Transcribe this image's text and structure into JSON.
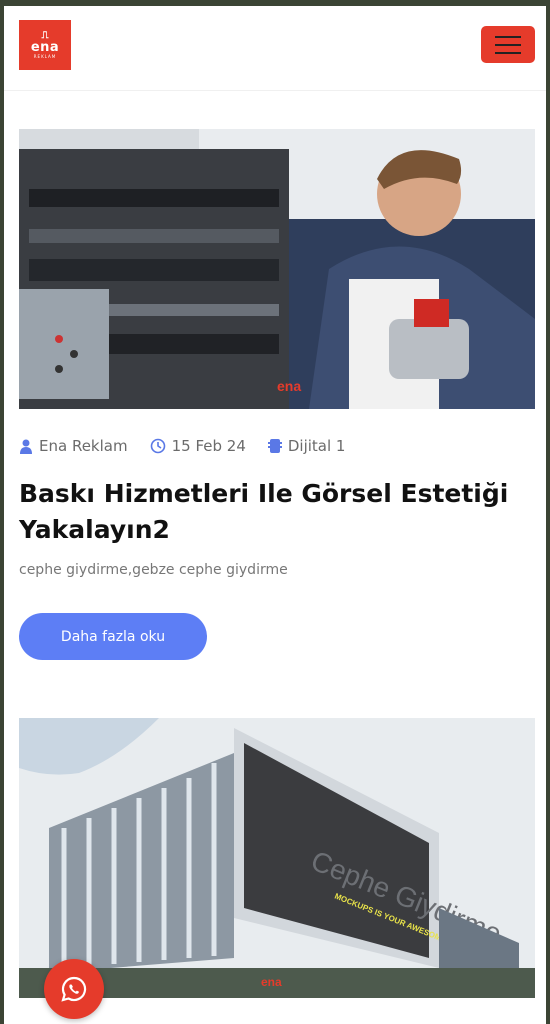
{
  "brand": {
    "logo_text": "ena",
    "logo_sub": "REKLAM",
    "accent_color": "#e53b2b"
  },
  "header": {
    "menu_icon": "hamburger-icon"
  },
  "posts": [
    {
      "image": "printing-press-man-with-paint-can",
      "author": "Ena Reklam",
      "date": "15 Feb 24",
      "category": "Dijital 1",
      "title": "Baskı Hizmetleri Ile Görsel Estetiği Yakalayın2",
      "excerpt": "cephe giydirme,gebze cephe giydirme",
      "read_more": "Daha fazla oku"
    },
    {
      "image": "building-facade-billboard-mockup",
      "billboard_text_1": "Cephe Giydirme",
      "billboard_text_2": "MOCKUPS IS YOUR AWESOME DESIGN"
    }
  ],
  "floating": {
    "whatsapp_icon": "whatsapp-icon"
  },
  "colors": {
    "button_blue": "#5d7ef5",
    "meta_icon_blue": "#5a78e6"
  }
}
